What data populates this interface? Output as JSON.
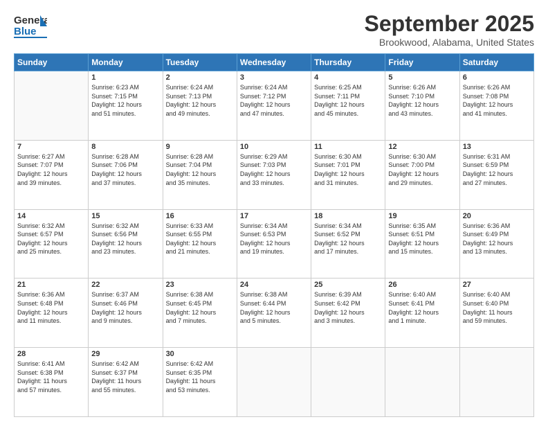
{
  "logo": {
    "line1": "General",
    "line2": "Blue"
  },
  "title": "September 2025",
  "subtitle": "Brookwood, Alabama, United States",
  "weekdays": [
    "Sunday",
    "Monday",
    "Tuesday",
    "Wednesday",
    "Thursday",
    "Friday",
    "Saturday"
  ],
  "weeks": [
    [
      {
        "day": "",
        "info": ""
      },
      {
        "day": "1",
        "info": "Sunrise: 6:23 AM\nSunset: 7:15 PM\nDaylight: 12 hours\nand 51 minutes."
      },
      {
        "day": "2",
        "info": "Sunrise: 6:24 AM\nSunset: 7:13 PM\nDaylight: 12 hours\nand 49 minutes."
      },
      {
        "day": "3",
        "info": "Sunrise: 6:24 AM\nSunset: 7:12 PM\nDaylight: 12 hours\nand 47 minutes."
      },
      {
        "day": "4",
        "info": "Sunrise: 6:25 AM\nSunset: 7:11 PM\nDaylight: 12 hours\nand 45 minutes."
      },
      {
        "day": "5",
        "info": "Sunrise: 6:26 AM\nSunset: 7:10 PM\nDaylight: 12 hours\nand 43 minutes."
      },
      {
        "day": "6",
        "info": "Sunrise: 6:26 AM\nSunset: 7:08 PM\nDaylight: 12 hours\nand 41 minutes."
      }
    ],
    [
      {
        "day": "7",
        "info": "Sunrise: 6:27 AM\nSunset: 7:07 PM\nDaylight: 12 hours\nand 39 minutes."
      },
      {
        "day": "8",
        "info": "Sunrise: 6:28 AM\nSunset: 7:06 PM\nDaylight: 12 hours\nand 37 minutes."
      },
      {
        "day": "9",
        "info": "Sunrise: 6:28 AM\nSunset: 7:04 PM\nDaylight: 12 hours\nand 35 minutes."
      },
      {
        "day": "10",
        "info": "Sunrise: 6:29 AM\nSunset: 7:03 PM\nDaylight: 12 hours\nand 33 minutes."
      },
      {
        "day": "11",
        "info": "Sunrise: 6:30 AM\nSunset: 7:01 PM\nDaylight: 12 hours\nand 31 minutes."
      },
      {
        "day": "12",
        "info": "Sunrise: 6:30 AM\nSunset: 7:00 PM\nDaylight: 12 hours\nand 29 minutes."
      },
      {
        "day": "13",
        "info": "Sunrise: 6:31 AM\nSunset: 6:59 PM\nDaylight: 12 hours\nand 27 minutes."
      }
    ],
    [
      {
        "day": "14",
        "info": "Sunrise: 6:32 AM\nSunset: 6:57 PM\nDaylight: 12 hours\nand 25 minutes."
      },
      {
        "day": "15",
        "info": "Sunrise: 6:32 AM\nSunset: 6:56 PM\nDaylight: 12 hours\nand 23 minutes."
      },
      {
        "day": "16",
        "info": "Sunrise: 6:33 AM\nSunset: 6:55 PM\nDaylight: 12 hours\nand 21 minutes."
      },
      {
        "day": "17",
        "info": "Sunrise: 6:34 AM\nSunset: 6:53 PM\nDaylight: 12 hours\nand 19 minutes."
      },
      {
        "day": "18",
        "info": "Sunrise: 6:34 AM\nSunset: 6:52 PM\nDaylight: 12 hours\nand 17 minutes."
      },
      {
        "day": "19",
        "info": "Sunrise: 6:35 AM\nSunset: 6:51 PM\nDaylight: 12 hours\nand 15 minutes."
      },
      {
        "day": "20",
        "info": "Sunrise: 6:36 AM\nSunset: 6:49 PM\nDaylight: 12 hours\nand 13 minutes."
      }
    ],
    [
      {
        "day": "21",
        "info": "Sunrise: 6:36 AM\nSunset: 6:48 PM\nDaylight: 12 hours\nand 11 minutes."
      },
      {
        "day": "22",
        "info": "Sunrise: 6:37 AM\nSunset: 6:46 PM\nDaylight: 12 hours\nand 9 minutes."
      },
      {
        "day": "23",
        "info": "Sunrise: 6:38 AM\nSunset: 6:45 PM\nDaylight: 12 hours\nand 7 minutes."
      },
      {
        "day": "24",
        "info": "Sunrise: 6:38 AM\nSunset: 6:44 PM\nDaylight: 12 hours\nand 5 minutes."
      },
      {
        "day": "25",
        "info": "Sunrise: 6:39 AM\nSunset: 6:42 PM\nDaylight: 12 hours\nand 3 minutes."
      },
      {
        "day": "26",
        "info": "Sunrise: 6:40 AM\nSunset: 6:41 PM\nDaylight: 12 hours\nand 1 minute."
      },
      {
        "day": "27",
        "info": "Sunrise: 6:40 AM\nSunset: 6:40 PM\nDaylight: 11 hours\nand 59 minutes."
      }
    ],
    [
      {
        "day": "28",
        "info": "Sunrise: 6:41 AM\nSunset: 6:38 PM\nDaylight: 11 hours\nand 57 minutes."
      },
      {
        "day": "29",
        "info": "Sunrise: 6:42 AM\nSunset: 6:37 PM\nDaylight: 11 hours\nand 55 minutes."
      },
      {
        "day": "30",
        "info": "Sunrise: 6:42 AM\nSunset: 6:35 PM\nDaylight: 11 hours\nand 53 minutes."
      },
      {
        "day": "",
        "info": ""
      },
      {
        "day": "",
        "info": ""
      },
      {
        "day": "",
        "info": ""
      },
      {
        "day": "",
        "info": ""
      }
    ]
  ]
}
